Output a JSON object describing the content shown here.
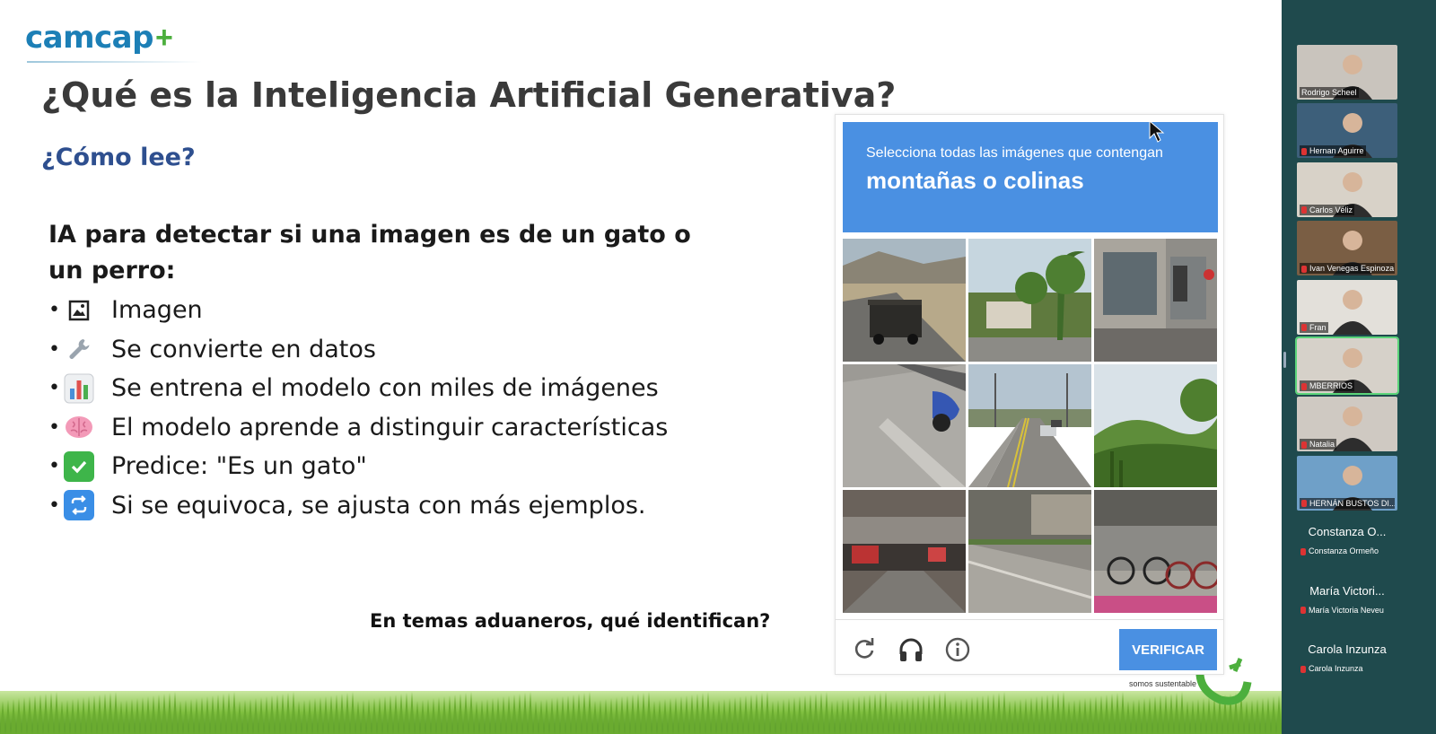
{
  "slide": {
    "logo": "camcap",
    "title": "¿Qué es la Inteligencia Artificial Generativa?",
    "subtitle": "¿Cómo lee?",
    "lead": "IA para detectar si una imagen es de un gato o un perro:",
    "bullets": [
      {
        "icon": "picture-icon",
        "text": "Imagen"
      },
      {
        "icon": "wrench-icon",
        "text": "Se convierte en datos"
      },
      {
        "icon": "bar-chart-icon",
        "text": "Se entrena el modelo con miles de imágenes"
      },
      {
        "icon": "brain-icon",
        "text": "El modelo aprende a distinguir características"
      },
      {
        "icon": "check-icon",
        "text": "Predice: \"Es un gato\""
      },
      {
        "icon": "repeat-icon",
        "text": "Si se equivoca, se ajusta con más ejemplos."
      }
    ],
    "question": "En temas aduaneros, qué identifican?",
    "badge_text": "somos sustentable"
  },
  "captcha": {
    "instruction": "Selecciona todas las imágenes que contengan",
    "target": "montañas o colinas",
    "verify_label": "VERIFICAR",
    "tiles": [
      "truck-road",
      "palm-houses",
      "storefront",
      "bike-lane",
      "street-traffic",
      "green-hills",
      "underpass",
      "sidewalk",
      "bicycles"
    ],
    "accent": "#4a90e2"
  },
  "participants": [
    {
      "name": "Rodrigo Scheel",
      "bg": "#c9c4bd",
      "active": false
    },
    {
      "name": "Hernan Aguirre",
      "bg": "#3d5f7a",
      "active": false
    },
    {
      "name": "Carlos Véliz",
      "bg": "#d8d2c8",
      "active": false
    },
    {
      "name": "Ivan Venegas Espinoza",
      "bg": "#7a5e44",
      "active": false
    },
    {
      "name": "Fran",
      "bg": "#e3e0da",
      "active": false
    },
    {
      "name": "MBERRIOS",
      "bg": "#d6d1c9",
      "active": true
    },
    {
      "name": "Natalia",
      "bg": "#cfc9c2",
      "active": false
    },
    {
      "name": "HERNÁN BUSTOS DI...",
      "bg": "#6fa0c8",
      "active": false
    }
  ],
  "participants_text": [
    {
      "display": "Constanza O...",
      "name": "Constanza Ormeño"
    },
    {
      "display": "María Victori...",
      "name": "María Victoria Neveu"
    },
    {
      "display": "Carola Inzunza",
      "name": "Carola Inzunza"
    }
  ]
}
